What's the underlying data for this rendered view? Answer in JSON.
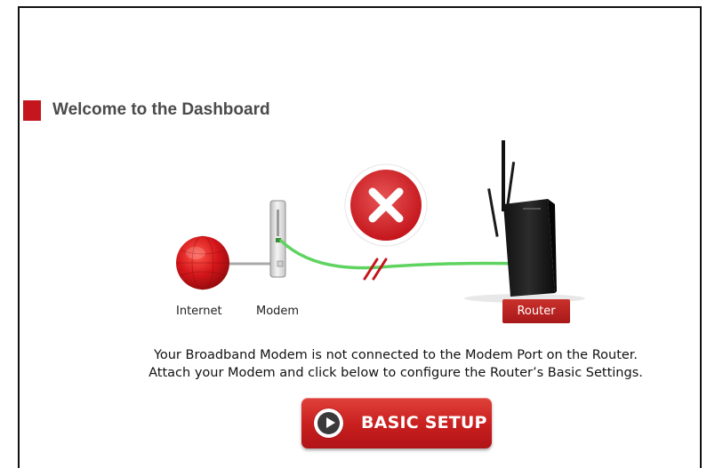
{
  "page": {
    "title": "Welcome to the Dashboard"
  },
  "diagram": {
    "internet_label": "Internet",
    "modem_label": "Modem",
    "router_label": "Router",
    "status": "disconnected",
    "status_icon": "x-icon"
  },
  "message": {
    "line1": "Your Broadband Modem is not connected to the Modem Port on the Router.",
    "line2": "Attach your Modem and click below to configure the Router’s Basic Settings."
  },
  "actions": {
    "basic_setup_label": "BASIC SETUP",
    "basic_setup_icon": "play-icon"
  },
  "colors": {
    "accent_red": "#c4161c",
    "cable_green": "#5fd35f",
    "title_gray": "#4a4a4a"
  }
}
